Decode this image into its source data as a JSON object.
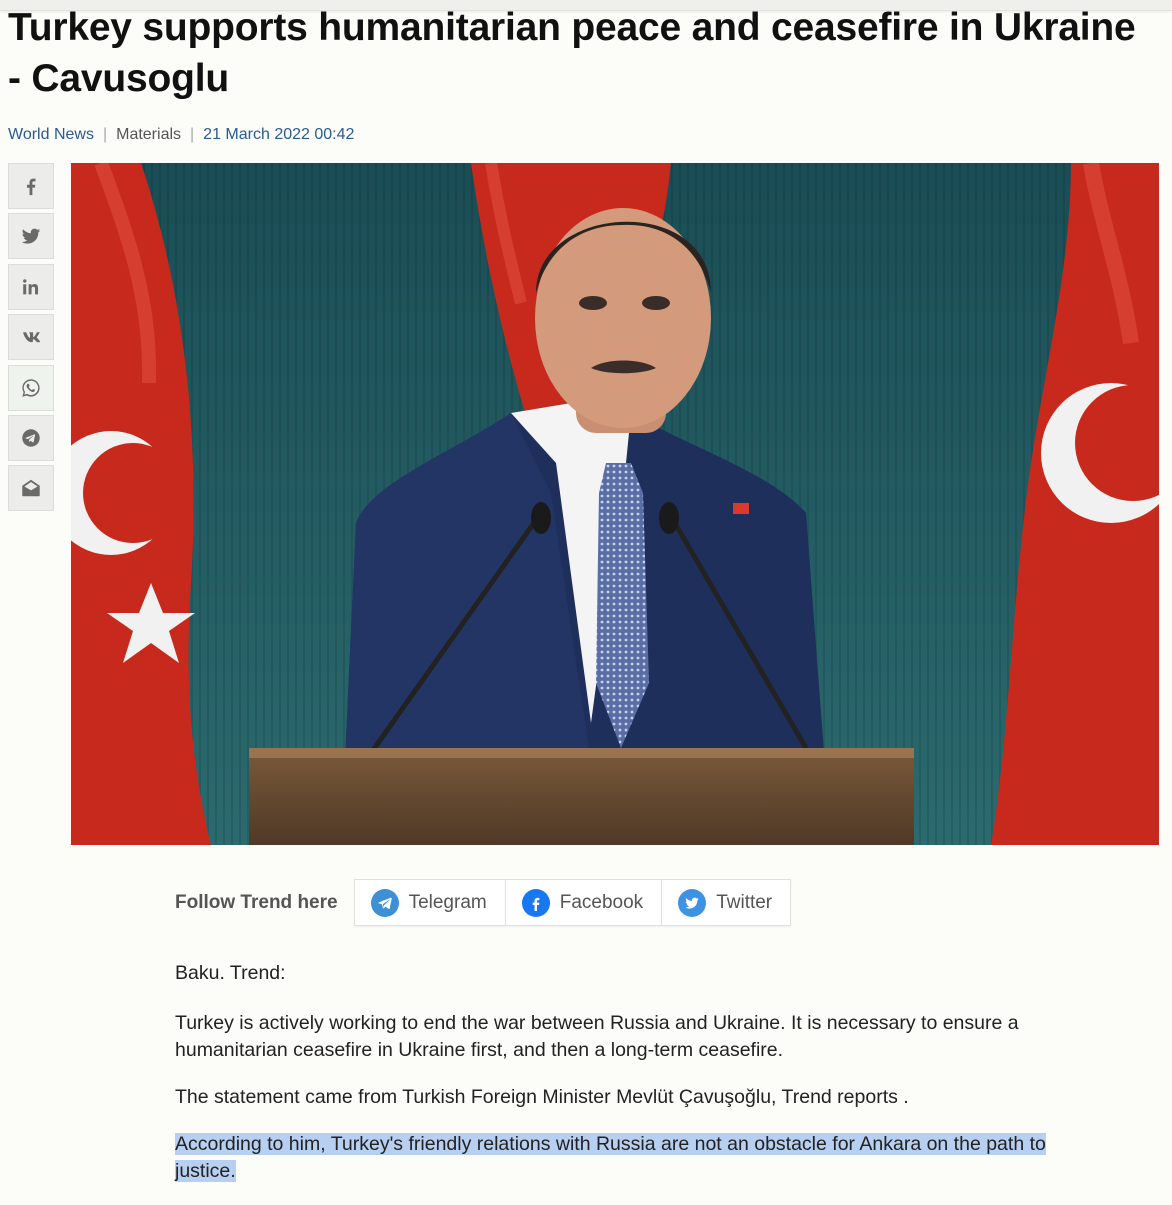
{
  "article": {
    "title": "Turkey supports humanitarian peace and ceasefire in Ukraine - Cavusoglu",
    "meta": {
      "category": "World News",
      "section": "Materials",
      "datetime": "21 March 2022 00:42"
    },
    "share_buttons": [
      {
        "icon": "facebook-icon"
      },
      {
        "icon": "twitter-icon"
      },
      {
        "icon": "linkedin-icon"
      },
      {
        "icon": "vk-icon"
      },
      {
        "icon": "whatsapp-icon"
      },
      {
        "icon": "telegram-icon"
      },
      {
        "icon": "email-icon"
      }
    ],
    "follow": {
      "label": "Follow Trend here",
      "buttons": [
        {
          "label": "Telegram",
          "icon": "telegram-icon",
          "color": "#3d8fd6"
        },
        {
          "label": "Facebook",
          "icon": "facebook-icon",
          "color": "#1877f2"
        },
        {
          "label": "Twitter",
          "icon": "twitter-icon",
          "color": "#3d93e2"
        }
      ]
    },
    "body": {
      "dateline": "Baku. Trend:",
      "p1": "Turkey is actively working to end the war between Russia and Ukraine. It is necessary to ensure a humanitarian ceasefire in Ukraine first, and then a long-term ceasefire.",
      "p2": "The statement came from Turkish Foreign Minister Mevlüt Çavuşoğlu, Trend reports .",
      "p3_highlighted": "According to him, Turkey's friendly relations with Russia are not an obstacle for Ankara on the path to justice."
    },
    "colors": {
      "link": "#2a5b94",
      "highlight": "#b7cff0"
    }
  }
}
